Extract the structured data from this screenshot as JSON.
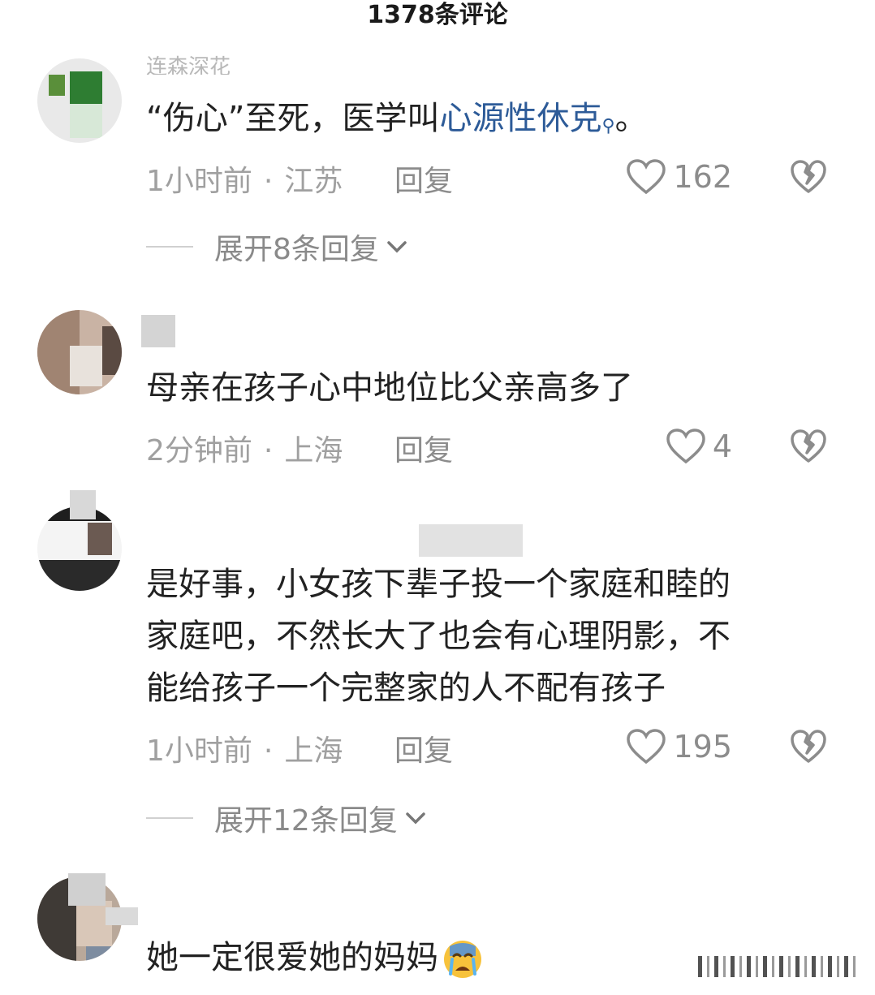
{
  "header": {
    "title": "1378条评论"
  },
  "comments": [
    {
      "username": "连森深花",
      "text_before": "“伤心”至死，医学叫",
      "link_text": "心源性休克",
      "text_after": "。",
      "time": "1小时前",
      "location": "江苏",
      "reply_label": "回复",
      "likes": "162",
      "expand_label": "展开8条回复"
    },
    {
      "username": "",
      "text": "母亲在孩子心中地位比父亲高多了",
      "time": "2分钟前",
      "location": "上海",
      "reply_label": "回复",
      "likes": "4"
    },
    {
      "username": "",
      "text_lines": [
        "是好事，小女孩下辈子投一个家庭和睦的",
        "家庭吧，不然长大了也会有心理阴影，不",
        "能给孩子一个完整家的人不配有孩子"
      ],
      "time": "1小时前",
      "location": "上海",
      "reply_label": "回复",
      "likes": "195",
      "expand_label": "展开12条回复"
    },
    {
      "username": "",
      "text": "她一定很爱她的妈妈",
      "emoji": "crying-face"
    }
  ],
  "colors": {
    "link": "#2d5b98",
    "meta": "#a0a0a0",
    "text": "#222222"
  }
}
